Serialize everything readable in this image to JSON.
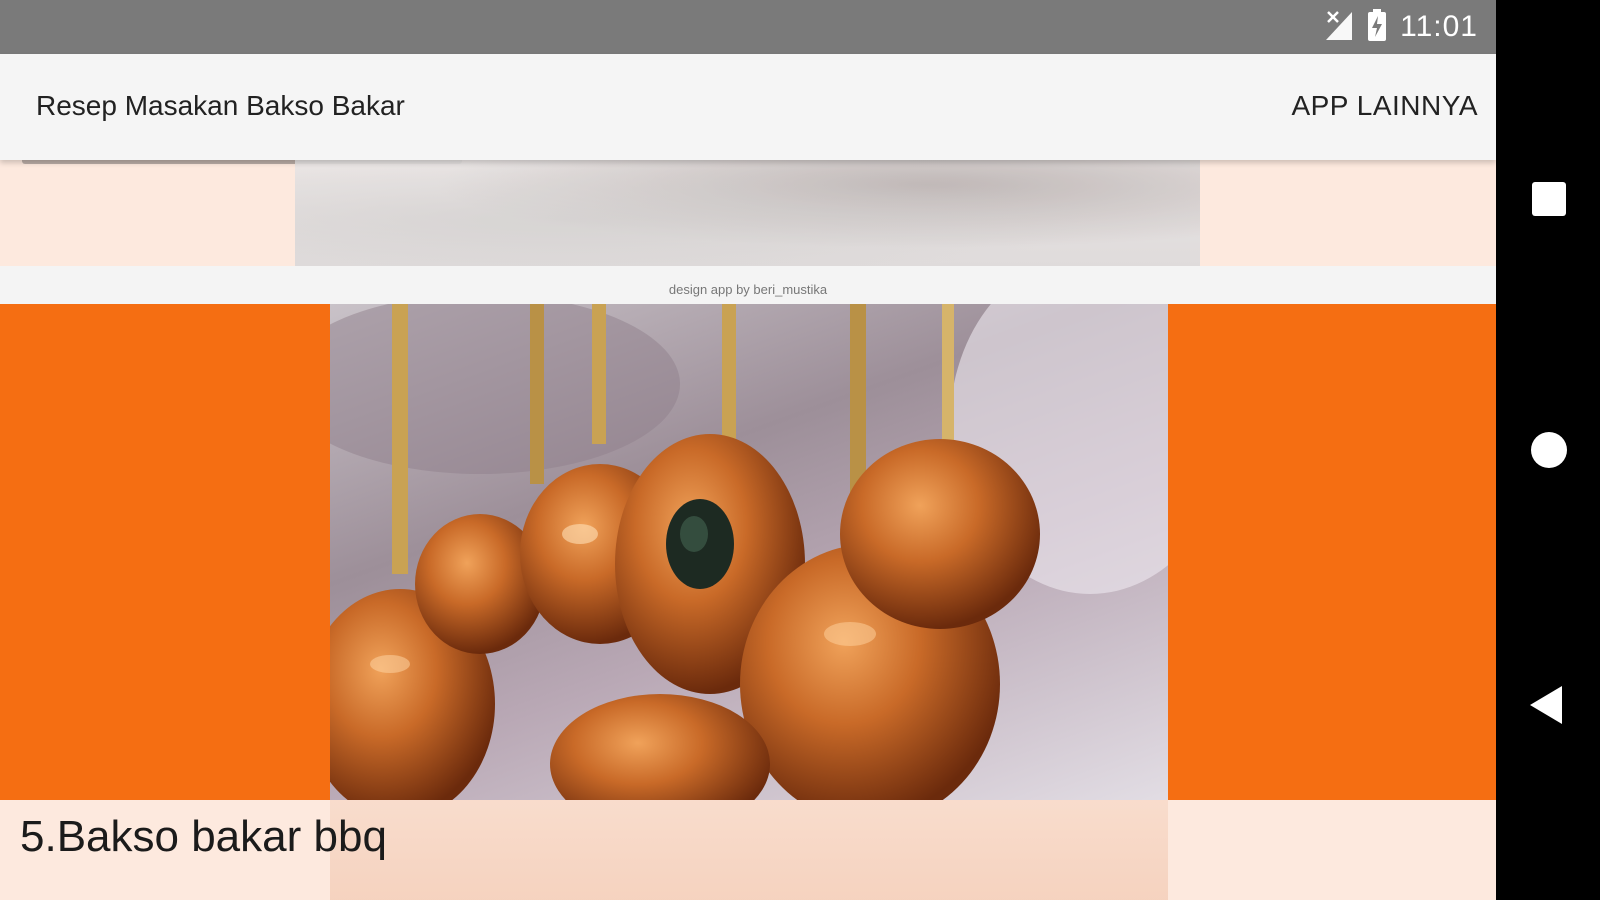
{
  "status_bar": {
    "time": "11:01",
    "icons": [
      "signal-off-icon",
      "battery-charging-icon"
    ]
  },
  "app_bar": {
    "title": "Resep Masakan Bakso Bakar",
    "action_label": "APP LAINNYA"
  },
  "content": {
    "credit": "design app by beri_mustika",
    "item": {
      "caption": "5.Bakso bakar bbq"
    }
  },
  "nav_bar": {
    "icons": [
      "recent-apps-icon",
      "home-icon",
      "back-icon"
    ]
  },
  "colors": {
    "accent": "#f56e12",
    "card_background": "#fde9de",
    "status_bar": "#7a7a7a",
    "app_bar": "#f5f5f5"
  }
}
